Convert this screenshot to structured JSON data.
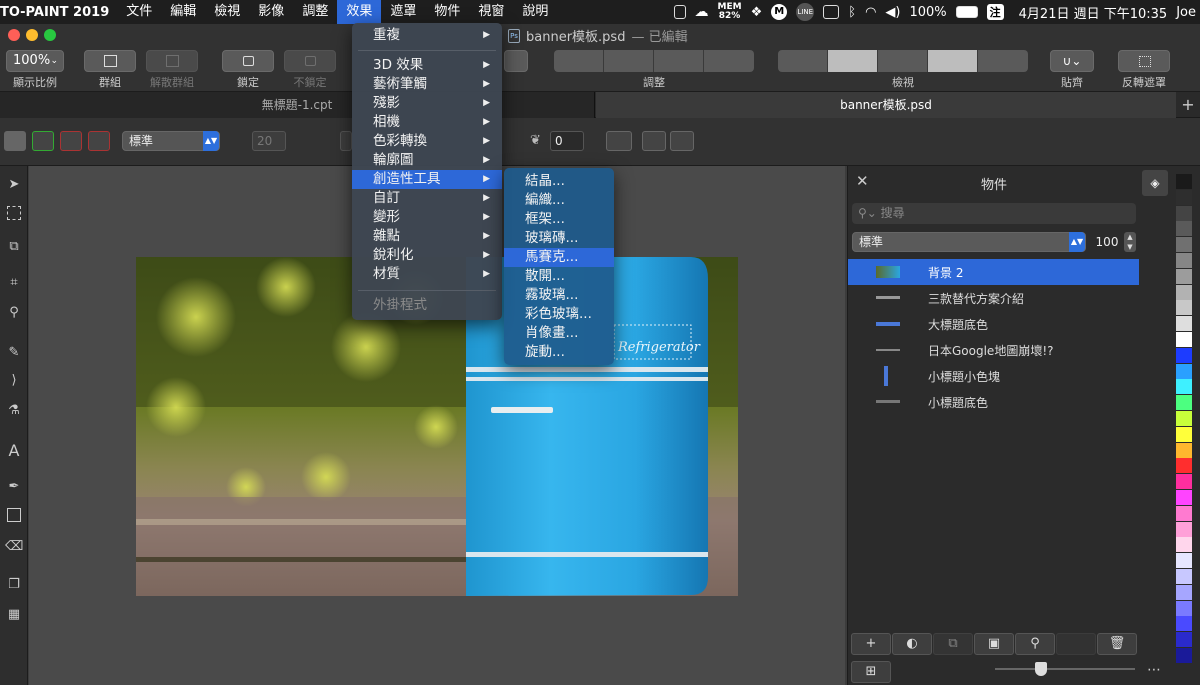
{
  "menubar": {
    "app_name": "TO-PAINT 2019",
    "items": [
      "文件",
      "編輯",
      "檢視",
      "影像",
      "調整",
      "效果",
      "遮罩",
      "物件",
      "視窗",
      "說明"
    ],
    "active_index": 5,
    "status": {
      "mem_label": "MEM",
      "mem_value": "82%",
      "battery": "100%",
      "input_method": "注",
      "datetime": "4月21日 週日 下午10:35",
      "user": "Joe"
    }
  },
  "window": {
    "doc_name": "banner模板.psd",
    "doc_state": "— 已編輯"
  },
  "toolbar": {
    "zoom_value": "100%",
    "labels": {
      "zoom": "顯示比例",
      "group": "群組",
      "ungroup": "解散群組",
      "lock": "鎖定",
      "unlock": "不鎖定",
      "adjust": "調整",
      "view": "檢視",
      "snap": "貼齊",
      "invert_mask": "反轉遮罩"
    }
  },
  "tabs": [
    {
      "label": "無標題-1.cpt",
      "active": false
    },
    {
      "label": "banner模板.psd",
      "active": true
    }
  ],
  "propbar": {
    "blend_mode": "標準",
    "width_value": "20",
    "feather_value": "0"
  },
  "effects_menu": {
    "items": [
      {
        "label": "重複",
        "submenu": true
      },
      {
        "label": "3D 效果",
        "submenu": true
      },
      {
        "label": "藝術筆觸",
        "submenu": true
      },
      {
        "label": "殘影",
        "submenu": true
      },
      {
        "label": "相機",
        "submenu": true
      },
      {
        "label": "色彩轉換",
        "submenu": true
      },
      {
        "label": "輪廓圖",
        "submenu": true
      },
      {
        "label": "創造性工具",
        "submenu": true,
        "highlighted": true
      },
      {
        "label": "自訂",
        "submenu": true
      },
      {
        "label": "變形",
        "submenu": true
      },
      {
        "label": "雜點",
        "submenu": true
      },
      {
        "label": "銳利化",
        "submenu": true
      },
      {
        "label": "材質",
        "submenu": true
      }
    ],
    "plugins_label": "外掛程式"
  },
  "creative_submenu": {
    "items": [
      "結晶...",
      "編織...",
      "框架...",
      "玻璃磚...",
      "馬賽克...",
      "散開...",
      "霧玻璃...",
      "彩色玻璃...",
      "肖像畫...",
      "旋動..."
    ],
    "highlighted_index": 4
  },
  "canvas": {
    "fridge_label": "Refrigerator"
  },
  "objects_panel": {
    "title": "物件",
    "search_placeholder": "搜尋",
    "blend_mode": "標準",
    "opacity": "100",
    "objects": [
      {
        "label": "背景 2",
        "selected": true
      },
      {
        "label": "三款替代方案介紹",
        "selected": false
      },
      {
        "label": "大標題底色",
        "selected": false
      },
      {
        "label": "日本Google地圖崩壞!?",
        "selected": false
      },
      {
        "label": "小標題小色塊",
        "selected": false
      },
      {
        "label": "小標題底色",
        "selected": false
      }
    ],
    "opacity_slider_fraction": 0.33
  },
  "swatches": [
    "#1a1a1a",
    "#2e2e2e",
    "#444444",
    "#5a5a5a",
    "#707070",
    "#868686",
    "#9c9c9c",
    "#b2b2b2",
    "#c8c8c8",
    "#dedede",
    "#ffffff",
    "#1d3cff",
    "#2aa0ff",
    "#3ef0ff",
    "#4cff80",
    "#c8ff3a",
    "#ffff3a",
    "#ffb82e",
    "#ff2e2e",
    "#ff2e9e",
    "#ff44ff",
    "#ff7ad0",
    "#ffa0d8",
    "#ffd6ec",
    "#e6e6ff",
    "#c8c8ff",
    "#a6a6ff",
    "#7a7aff",
    "#4a4aff",
    "#2a2acc",
    "#1a1a99"
  ]
}
